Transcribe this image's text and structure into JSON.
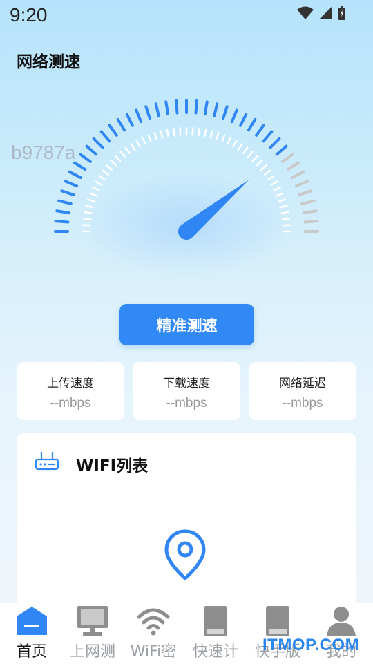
{
  "status_bar": {
    "time": "9:20"
  },
  "header": {
    "title": "网络测速"
  },
  "watermark": "b9787a",
  "gauge": {
    "needle_level": 0.78,
    "active_color": "#2f86f4",
    "inactive_color": "#c9c9c9"
  },
  "test_button": {
    "label": "精准测速"
  },
  "stats": [
    {
      "label": "上传速度",
      "value": "--mbps"
    },
    {
      "label": "下载速度",
      "value": "--mbps"
    },
    {
      "label": "网络延迟",
      "value": "--mbps"
    }
  ],
  "wifi_list": {
    "title": "WIFI列表"
  },
  "tabs": [
    {
      "label": "首页",
      "icon": "home-icon",
      "active": true
    },
    {
      "label": "上网测",
      "icon": "monitor-icon",
      "active": false
    },
    {
      "label": "WiFi密",
      "icon": "wifi-icon",
      "active": false
    },
    {
      "label": "快速计",
      "icon": "book-icon",
      "active": false
    },
    {
      "label": "快手版",
      "icon": "book-icon",
      "active": false
    },
    {
      "label": "我的",
      "icon": "user-icon",
      "active": false
    }
  ],
  "brand_watermark": "ITMOP.COM",
  "colors": {
    "accent": "#3189f5",
    "bg_top": "#b5e3fb",
    "bg_bottom": "#f1f6fb"
  }
}
